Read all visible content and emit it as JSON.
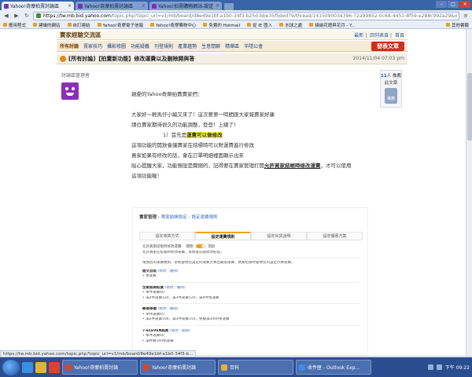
{
  "browser": {
    "tabs": [
      {
        "label": "Yahoo!奇摩拍賣討論區",
        "active": true
      },
      {
        "label": "Yahoo!奇摩拍賣討論區",
        "active": false
      },
      {
        "label": "Yahoo!拍賣購物網站-設定",
        "active": false
      }
    ],
    "url_host": "https://tw.mb.bid.yahoo.com",
    "url_path": "/topic.php?topic_url=v1/mb/board/d8e49e1bf-a1b0-34f3-b25d-bbe35f5ded79/thread/1415090034396-72a99852-0c68-4451-8f59-e288c992a29&o",
    "bookmarks": [
      "應用程式",
      "建議的網站",
      "自訂連結",
      "Yahoo!奇摩電子信箱",
      "Yahoo!奇摩購物中心",
      "免費的 Hotmail",
      "從 IE 匯入",
      "水球之處",
      "描繪花語與花月 - Y..."
    ],
    "other_bookmarks": "其他書籤"
  },
  "site": {
    "title": "賣家經驗交流區",
    "links": [
      "最新",
      "回列表頁",
      "首頁"
    ],
    "menu": [
      "所有討論",
      "賣家技巧",
      "攝影修圖",
      "功能疑義",
      "刊登規則",
      "產業趨勢",
      "生意閒聊",
      "精華區",
      "半隱公會"
    ],
    "post_button": "發表文章"
  },
  "post": {
    "title": "[所有討論]【拍賣新功能】修改運費以及刪除開與答",
    "date": "2014/11/04 07:03 pm",
    "author": "討論區管理者",
    "likes": "11",
    "likes_suffix": "人 推薦",
    "like_label": "此文章",
    "thumb_label": "推薦",
    "paragraphs": [
      "親愛的Yahoo奇摩拍賣賣家們：",
      "大家好～輕馬仔小編又來了！這次要第一時間跟大家報賣家好康",
      "請位賣家期待很久的功能調整，登登！上線了！"
    ],
    "point_prefix": "1）首先是",
    "point_highlight": "運費可以做修改",
    "paragraphs2": [
      "這項功能的開放會讓賣家在結標時可以對運費進行修改",
      "買家如果有修改的話，會在訂單明細裡面顯示出來"
    ],
    "reminder_prefix": "貼心提醒大家，功能預設是關閉的，記得要在賣家管理打開",
    "reminder_bold": "允許買家結帳時修改運費",
    "reminder_suffix": "，才可以使用",
    "closing": "這項功能喔！"
  },
  "embed": {
    "breadcrumb": [
      "賣家管理",
      "賣家結帳設定",
      "設定運費規則"
    ],
    "tabs": [
      "設定收款方式",
      "設定運費規則",
      "設定出貨說明",
      "設定優惠方案"
    ],
    "active_tab": 1,
    "toggle_label": "允許買家結帳時修改運費：",
    "toggle_state_on": "開啟",
    "toggle_state_off": "關閉",
    "toggle_note": "允許買家在結帳時修改運費，系統會記錄修改紀錄。",
    "intro": "增加您的運費規則，系統會依您設定的運費計算出最低運費，買家結帳時會依您的設定計算運費。",
    "sections": [
      {
        "title": "面交自取",
        "tags": "(修改｜刪除)",
        "lines": [
          "免運費"
        ]
      },
      {
        "title": "全家超商取貨",
        "tags": "(修改｜刪除)",
        "lines": [
          "單件運費60",
          "滿2件運費120，滿3件運費120，滿4件免運費",
          ""
        ]
      },
      {
        "title": "郵寄掛號",
        "tags": "(修改｜刪除)",
        "lines": [
          "單件運費65",
          "滿2件運費100，滿3件運費150，免費滿3000免運費"
        ]
      },
      {
        "title": "7-ELEVEN超商",
        "tags": "(修改｜刪除)",
        "lines": [
          "單件運費60",
          "滿件數500免運費"
        ]
      }
    ]
  },
  "status_bar": "https://tw.mb.bid.yahoo.com/topic.php?topic_url=v1/mb/board/8e49e1bf-a1b0-34f3-b...",
  "taskbar": {
    "tasks": [
      "Yahoo!奇摩拍賣討論",
      "Yahoo!奇摩拍賣討論",
      "百科",
      "收件匣 - Outlook Exp..."
    ],
    "clock": "下午 09:22"
  },
  "colors": {
    "accent": "#c8321f",
    "highlight": "#ffff33",
    "link": "#2a57a3",
    "avatar": "#8b2fb7"
  }
}
